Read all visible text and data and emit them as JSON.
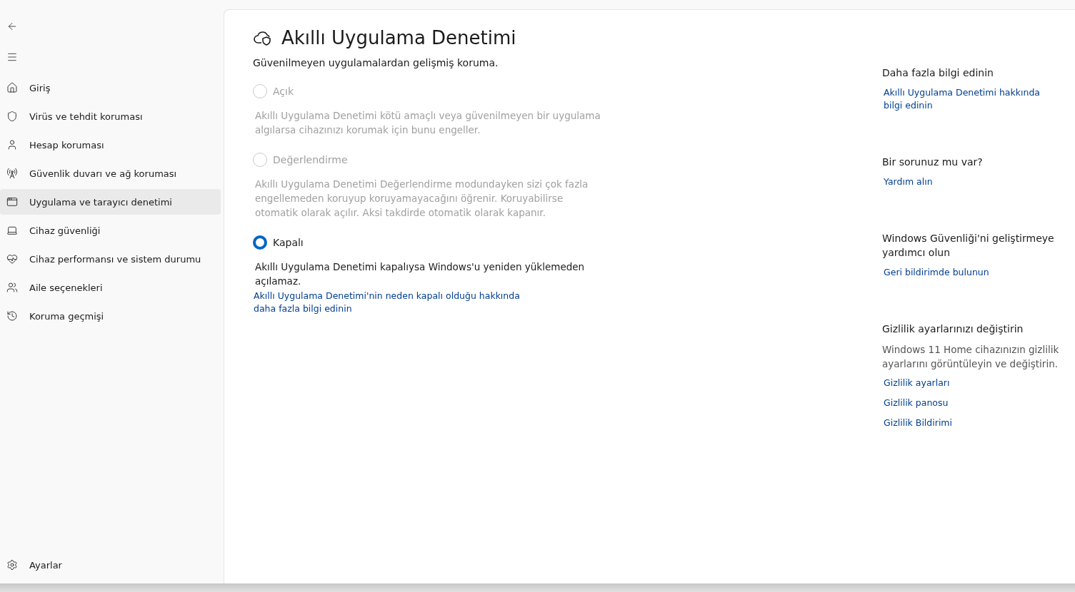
{
  "sidebar": {
    "items": [
      {
        "label": "Giriş",
        "selected": false
      },
      {
        "label": "Virüs ve tehdit koruması",
        "selected": false
      },
      {
        "label": "Hesap koruması",
        "selected": false
      },
      {
        "label": "Güvenlik duvarı ve ağ koruması",
        "selected": false
      },
      {
        "label": "Uygulama ve tarayıcı denetimi",
        "selected": true
      },
      {
        "label": "Cihaz güvenliği",
        "selected": false
      },
      {
        "label": "Cihaz performansı ve sistem durumu",
        "selected": false
      },
      {
        "label": "Aile seçenekleri",
        "selected": false
      },
      {
        "label": "Koruma geçmişi",
        "selected": false
      }
    ],
    "settings": "Ayarlar"
  },
  "page": {
    "title": "Akıllı Uygulama Denetimi",
    "subtitle": "Güvenilmeyen uygulamalardan gelişmiş koruma.",
    "options": [
      {
        "label": "Açık",
        "selected": false,
        "disabled": true,
        "description": "Akıllı Uygulama Denetimi kötü amaçlı veya güvenilmeyen bir uygulama algılarsa cihazınızı korumak için bunu engeller."
      },
      {
        "label": "Değerlendirme",
        "selected": false,
        "disabled": true,
        "description": "Akıllı Uygulama Denetimi Değerlendirme modundayken sizi çok fazla engellemeden koruyup koruyamayacağını öğrenir. Koruyabilirse otomatik olarak açılır. Aksi takdirde otomatik olarak kapanır."
      },
      {
        "label": "Kapalı",
        "selected": true,
        "disabled": false,
        "description": "Akıllı Uygulama Denetimi kapalıysa Windows'u yeniden yüklemeden açılamaz.",
        "link": "Akıllı Uygulama Denetimi'nin neden kapalı olduğu hakkında daha fazla bilgi edinin"
      }
    ]
  },
  "aside": [
    {
      "heading": "Daha fazla bilgi edinin",
      "links": [
        "Akıllı Uygulama Denetimi hakkında bilgi edinin"
      ]
    },
    {
      "heading": "Bir sorunuz mu var?",
      "links": [
        "Yardım alın"
      ]
    },
    {
      "heading": "Windows Güvenliği'ni geliştirmeye yardımcı olun",
      "links": [
        "Geri bildirimde bulunun"
      ]
    },
    {
      "heading": "Gizlilik ayarlarınızı değiştirin",
      "text": "Windows 11 Home cihazınızın gizlilik ayarlarını görüntüleyin ve değiştirin.",
      "links": [
        "Gizlilik ayarları",
        "Gizlilik panosu",
        "Gizlilik Bildirimi"
      ]
    }
  ]
}
